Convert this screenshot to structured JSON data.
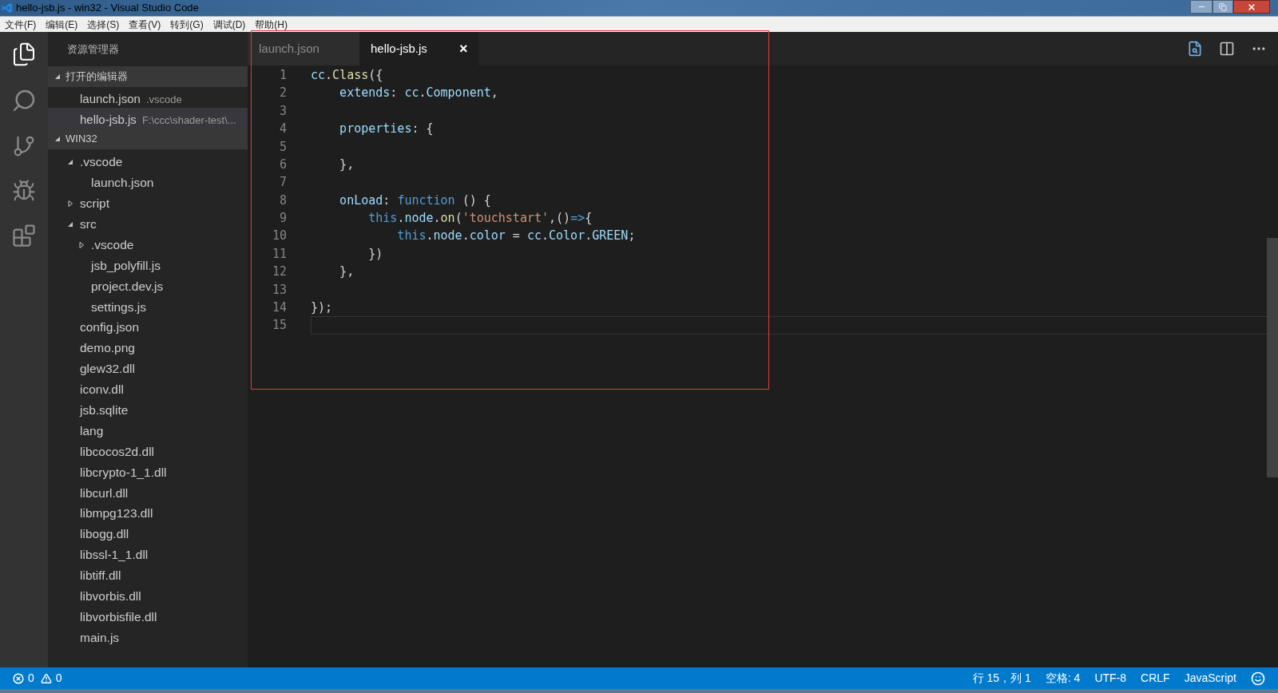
{
  "window": {
    "title": "hello-jsb.js - win32 - Visual Studio Code"
  },
  "menu": [
    "文件(F)",
    "编辑(E)",
    "选择(S)",
    "查看(V)",
    "转到(G)",
    "调试(D)",
    "帮助(H)"
  ],
  "sidebar": {
    "title": "资源管理器",
    "open_editors": {
      "label": "打开的编辑器",
      "expanded": true,
      "items": [
        {
          "name": "launch.json",
          "path": ".vscode",
          "selected": false
        },
        {
          "name": "hello-jsb.js",
          "path": "F:\\ccc\\shader-test\\...",
          "selected": true
        }
      ]
    },
    "folder": {
      "label": "WIN32",
      "expanded": true,
      "children": [
        {
          "name": ".vscode",
          "kind": "folder",
          "expanded": true,
          "children": [
            {
              "name": "launch.json",
              "kind": "file"
            }
          ]
        },
        {
          "name": "script",
          "kind": "folder",
          "expanded": false
        },
        {
          "name": "src",
          "kind": "folder",
          "expanded": true,
          "children": [
            {
              "name": ".vscode",
              "kind": "folder",
              "expanded": false
            },
            {
              "name": "jsb_polyfill.js",
              "kind": "file"
            },
            {
              "name": "project.dev.js",
              "kind": "file"
            },
            {
              "name": "settings.js",
              "kind": "file"
            }
          ]
        },
        {
          "name": "config.json",
          "kind": "file"
        },
        {
          "name": "demo.png",
          "kind": "file"
        },
        {
          "name": "glew32.dll",
          "kind": "file"
        },
        {
          "name": "iconv.dll",
          "kind": "file"
        },
        {
          "name": "jsb.sqlite",
          "kind": "file"
        },
        {
          "name": "lang",
          "kind": "file"
        },
        {
          "name": "libcocos2d.dll",
          "kind": "file"
        },
        {
          "name": "libcrypto-1_1.dll",
          "kind": "file"
        },
        {
          "name": "libcurl.dll",
          "kind": "file"
        },
        {
          "name": "libmpg123.dll",
          "kind": "file"
        },
        {
          "name": "libogg.dll",
          "kind": "file"
        },
        {
          "name": "libssl-1_1.dll",
          "kind": "file"
        },
        {
          "name": "libtiff.dll",
          "kind": "file"
        },
        {
          "name": "libvorbis.dll",
          "kind": "file"
        },
        {
          "name": "libvorbisfile.dll",
          "kind": "file"
        },
        {
          "name": "main.js",
          "kind": "file"
        }
      ]
    }
  },
  "tabs": [
    {
      "label": "launch.json",
      "selected": false
    },
    {
      "label": "hello-jsb.js",
      "selected": true,
      "close": "×"
    }
  ],
  "editor": {
    "lines": [
      {
        "number": "1",
        "current": false,
        "tokens": [
          {
            "kind": "var",
            "text": "cc"
          },
          {
            "kind": "plain",
            "text": "."
          },
          {
            "kind": "func",
            "text": "Class"
          },
          {
            "kind": "plain",
            "text": "({"
          }
        ]
      },
      {
        "number": "2",
        "current": false,
        "tokens": [
          {
            "kind": "var",
            "text": "    extends"
          },
          {
            "kind": "plain",
            "text": ": "
          },
          {
            "kind": "var",
            "text": "cc"
          },
          {
            "kind": "plain",
            "text": "."
          },
          {
            "kind": "var",
            "text": "Component"
          },
          {
            "kind": "plain",
            "text": ","
          }
        ]
      },
      {
        "number": "3",
        "current": false
      },
      {
        "number": "4",
        "current": false,
        "tokens": [
          {
            "kind": "var",
            "text": "    properties"
          },
          {
            "kind": "plain",
            "text": ": {"
          }
        ]
      },
      {
        "number": "5",
        "current": false
      },
      {
        "number": "6",
        "current": false,
        "tokens": [
          {
            "kind": "plain",
            "text": "    },"
          }
        ]
      },
      {
        "number": "7",
        "current": false
      },
      {
        "number": "8",
        "current": false,
        "tokens": [
          {
            "kind": "var",
            "text": "    onLoad"
          },
          {
            "kind": "plain",
            "text": ": "
          },
          {
            "kind": "keyword",
            "text": "function"
          },
          {
            "kind": "plain",
            "text": " () {"
          }
        ]
      },
      {
        "number": "9",
        "current": false,
        "tokens": [
          {
            "kind": "keyword",
            "text": "        this"
          },
          {
            "kind": "plain",
            "text": "."
          },
          {
            "kind": "var",
            "text": "node"
          },
          {
            "kind": "plain",
            "text": "."
          },
          {
            "kind": "func",
            "text": "on"
          },
          {
            "kind": "plain",
            "text": "("
          },
          {
            "kind": "string",
            "text": "'touchstart'"
          },
          {
            "kind": "plain",
            "text": ",()"
          },
          {
            "kind": "keyword",
            "text": "=>"
          },
          {
            "kind": "plain",
            "text": "{"
          }
        ]
      },
      {
        "number": "10",
        "current": false,
        "tokens": [
          {
            "kind": "keyword",
            "text": "            this"
          },
          {
            "kind": "plain",
            "text": "."
          },
          {
            "kind": "var",
            "text": "node"
          },
          {
            "kind": "plain",
            "text": "."
          },
          {
            "kind": "var",
            "text": "color"
          },
          {
            "kind": "plain",
            "text": " = "
          },
          {
            "kind": "var",
            "text": "cc"
          },
          {
            "kind": "plain",
            "text": "."
          },
          {
            "kind": "var",
            "text": "Color"
          },
          {
            "kind": "plain",
            "text": "."
          },
          {
            "kind": "var",
            "text": "GREEN"
          },
          {
            "kind": "plain",
            "text": ";"
          }
        ]
      },
      {
        "number": "11",
        "current": false,
        "tokens": [
          {
            "kind": "plain",
            "text": "        })"
          }
        ]
      },
      {
        "number": "12",
        "current": false,
        "tokens": [
          {
            "kind": "plain",
            "text": "    },"
          }
        ]
      },
      {
        "number": "13",
        "current": false
      },
      {
        "number": "14",
        "current": false,
        "tokens": [
          {
            "kind": "plain",
            "text": "});"
          }
        ]
      },
      {
        "number": "15",
        "current": true
      }
    ]
  },
  "status_bar": {
    "errors": "0",
    "warnings": "0",
    "position": "行 15，列 1",
    "indent": "空格: 4",
    "encoding": "UTF-8",
    "eol": "CRLF",
    "language": "JavaScript"
  }
}
